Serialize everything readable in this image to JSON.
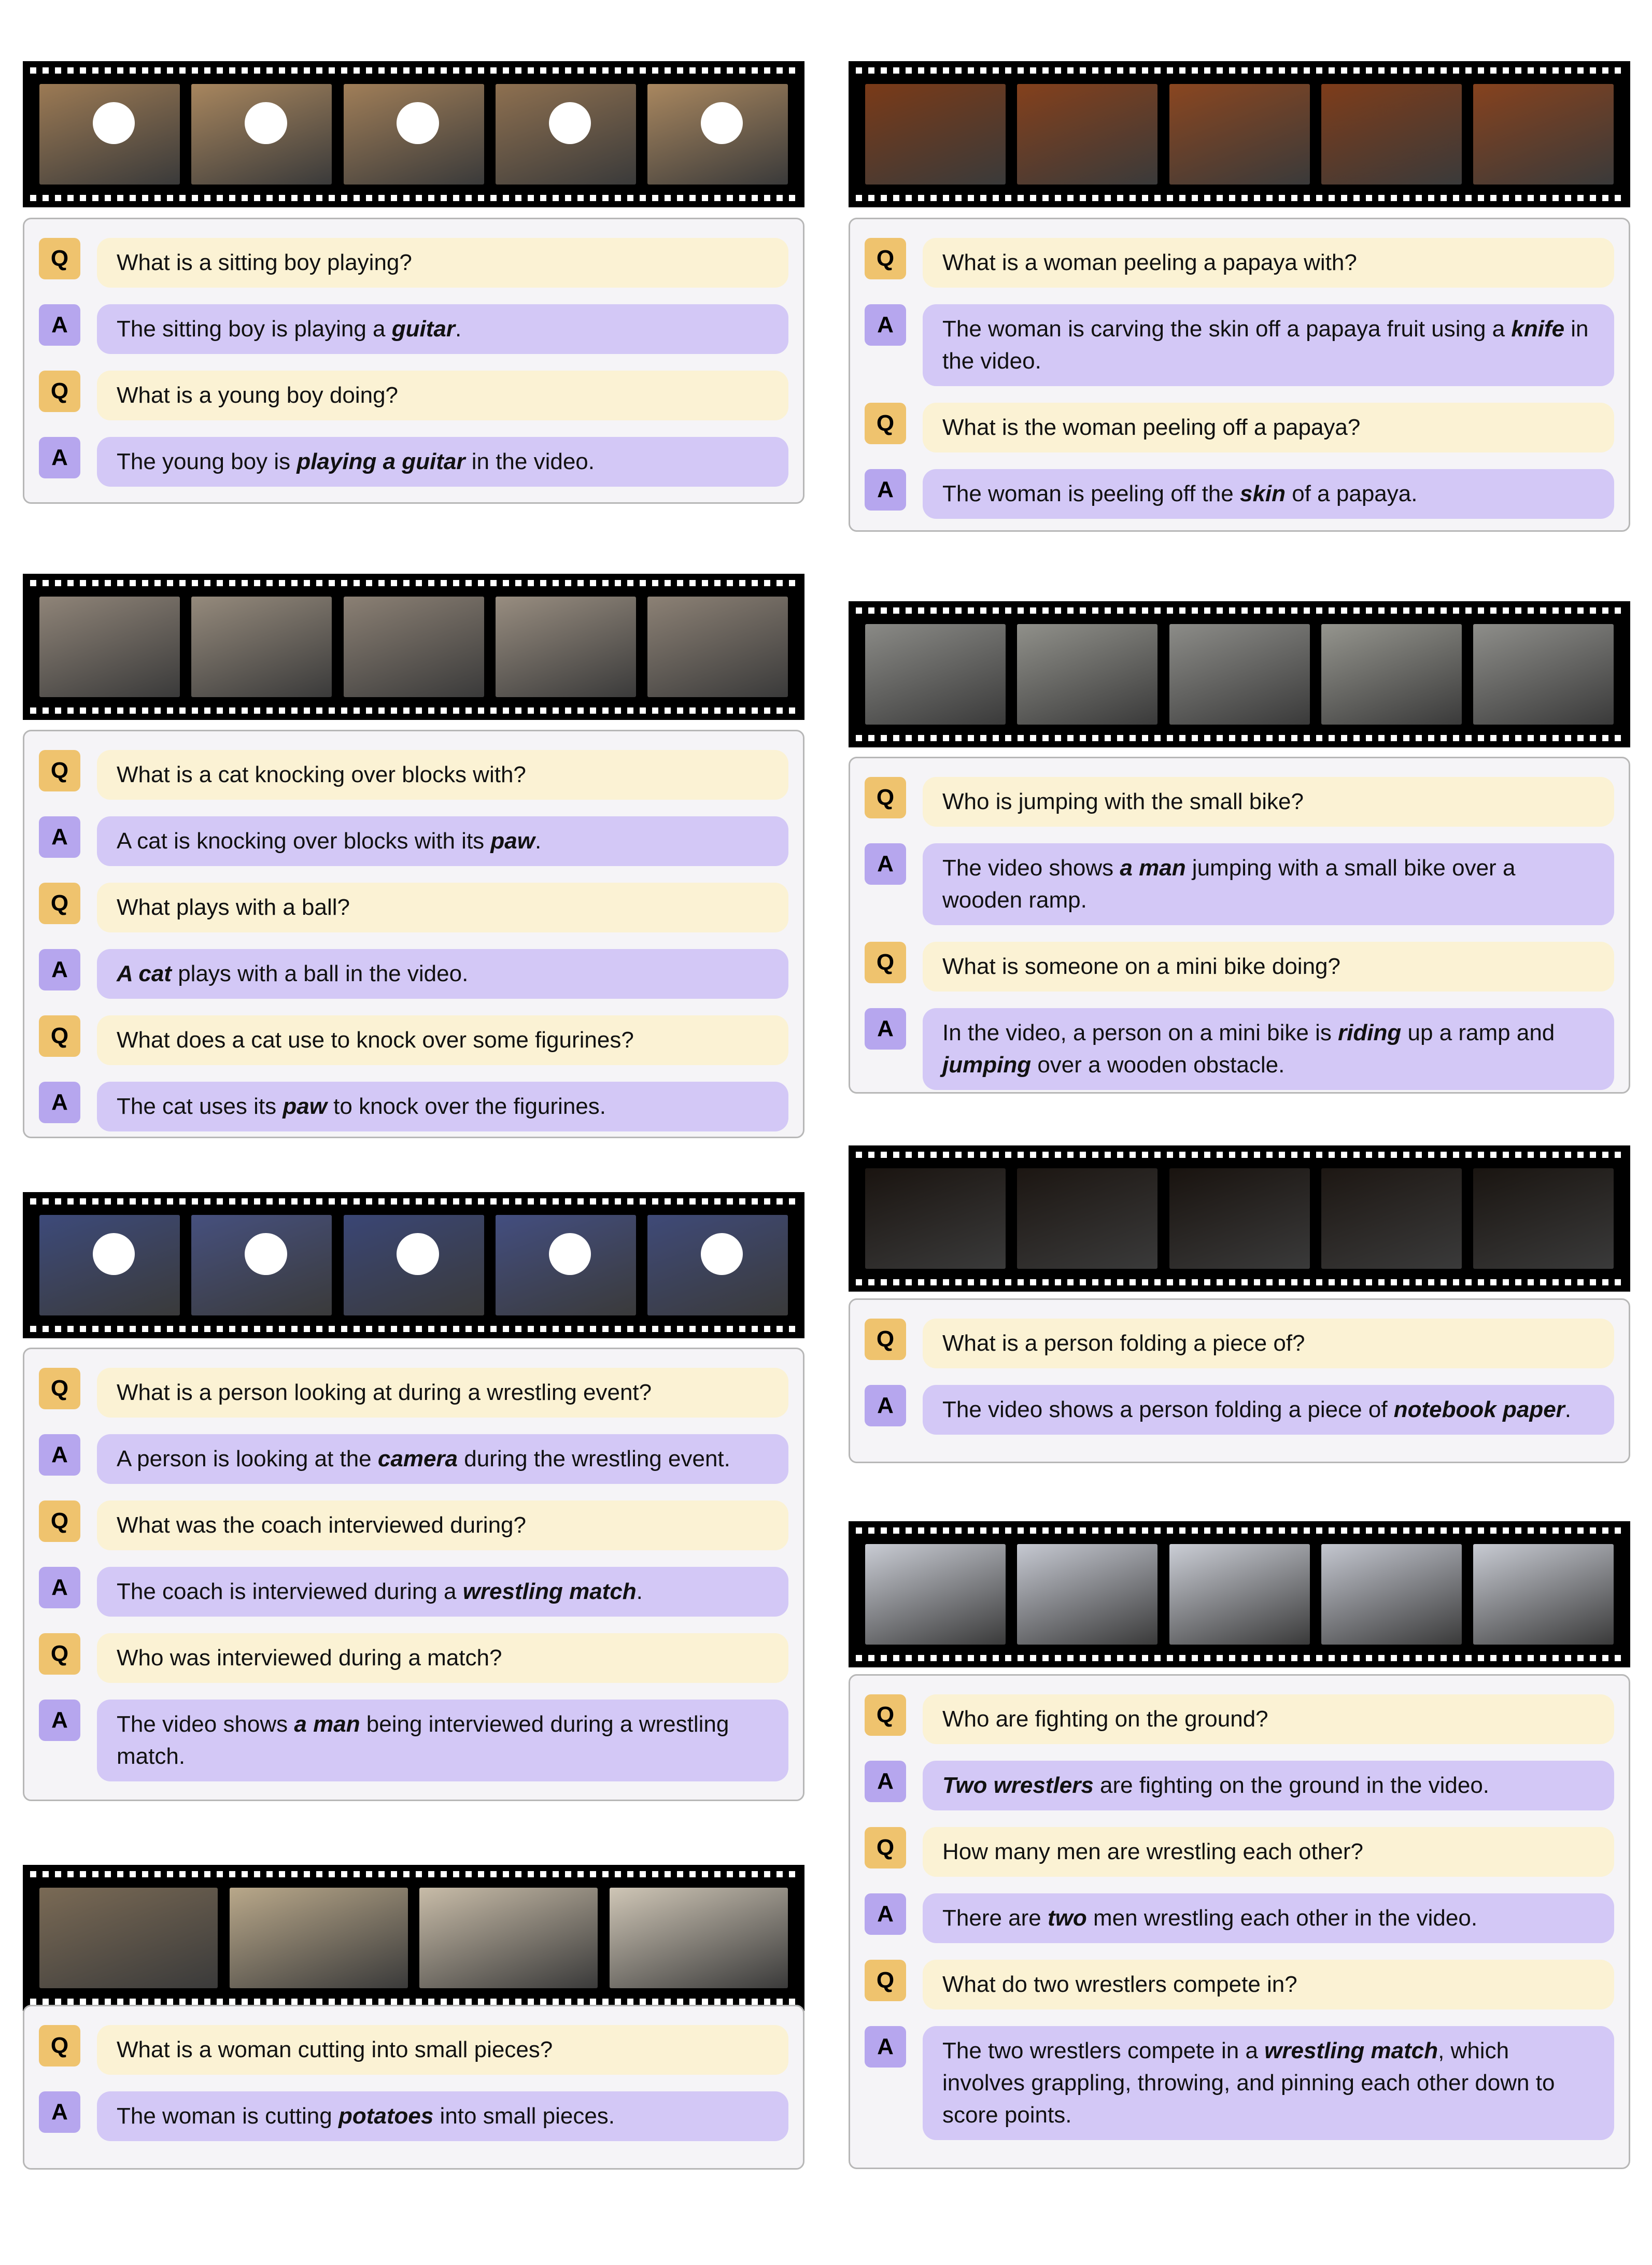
{
  "panels": [
    {
      "id": "boy-guitar",
      "frames": 5,
      "frame_colors": [
        "#9c7a54",
        "#a8865e",
        "#a07e58",
        "#8e7050",
        "#a9875f"
      ],
      "faces": true,
      "qa": [
        {
          "role": "Q",
          "parts": [
            {
              "t": "What is a sitting boy playing?"
            }
          ]
        },
        {
          "role": "A",
          "parts": [
            {
              "t": "The sitting boy is playing a "
            },
            {
              "t": "guitar",
              "em": true
            },
            {
              "t": "."
            }
          ]
        },
        {
          "role": "Q",
          "parts": [
            {
              "t": "What is a young boy doing?"
            }
          ]
        },
        {
          "role": "A",
          "parts": [
            {
              "t": "The young boy is "
            },
            {
              "t": "playing a guitar",
              "em": true
            },
            {
              "t": " in the video."
            }
          ]
        }
      ]
    },
    {
      "id": "cat-blocks",
      "frames": 5,
      "frame_colors": [
        "#8f8478",
        "#958a7c",
        "#8b8074",
        "#988d80",
        "#8c8175"
      ],
      "faces": false,
      "qa": [
        {
          "role": "Q",
          "parts": [
            {
              "t": "What is a cat knocking over blocks with?"
            }
          ]
        },
        {
          "role": "A",
          "parts": [
            {
              "t": "A cat is knocking over blocks with its "
            },
            {
              "t": "paw",
              "em": true
            },
            {
              "t": "."
            }
          ]
        },
        {
          "role": "Q",
          "parts": [
            {
              "t": "What plays with a ball?"
            }
          ]
        },
        {
          "role": "A",
          "parts": [
            {
              "t": "A cat",
              "em": true
            },
            {
              "t": " plays with a ball in the video."
            }
          ]
        },
        {
          "role": "Q",
          "parts": [
            {
              "t": "What does a cat use to knock over some figurines?"
            }
          ]
        },
        {
          "role": "A",
          "parts": [
            {
              "t": "The cat uses its "
            },
            {
              "t": "paw",
              "em": true
            },
            {
              "t": " to knock over the figurines."
            }
          ]
        }
      ]
    },
    {
      "id": "coach-interview",
      "frames": 5,
      "frame_colors": [
        "#3d4a7a",
        "#46507e",
        "#3a4675",
        "#434e80",
        "#3f4a78"
      ],
      "faces": true,
      "qa": [
        {
          "role": "Q",
          "parts": [
            {
              "t": "What is a person looking at during a wrestling event?"
            }
          ]
        },
        {
          "role": "A",
          "parts": [
            {
              "t": "A person is looking at the "
            },
            {
              "t": "camera",
              "em": true
            },
            {
              "t": " during the wrestling event."
            }
          ]
        },
        {
          "role": "Q",
          "parts": [
            {
              "t": "What was the coach interviewed during?"
            }
          ]
        },
        {
          "role": "A",
          "parts": [
            {
              "t": "The coach is interviewed during a "
            },
            {
              "t": "wrestling match",
              "em": true
            },
            {
              "t": "."
            }
          ]
        },
        {
          "role": "Q",
          "parts": [
            {
              "t": "Who was interviewed during a match?"
            }
          ]
        },
        {
          "role": "A",
          "parts": [
            {
              "t": "The video shows "
            },
            {
              "t": "a man",
              "em": true
            },
            {
              "t": " being interviewed during a wrestling match."
            }
          ]
        }
      ]
    },
    {
      "id": "potatoes",
      "frames": 4,
      "frame_colors": [
        "#7a6a55",
        "#b9a88a",
        "#c8bca8",
        "#cfc6b6"
      ],
      "faces": false,
      "qa": [
        {
          "role": "Q",
          "parts": [
            {
              "t": "What is a woman cutting into small pieces?"
            }
          ]
        },
        {
          "role": "A",
          "parts": [
            {
              "t": "The woman is cutting "
            },
            {
              "t": "potatoes",
              "em": true
            },
            {
              "t": " into small pieces."
            }
          ]
        }
      ]
    },
    {
      "id": "papaya",
      "frames": 5,
      "frame_colors": [
        "#7a3a18",
        "#84401c",
        "#8a4620",
        "#7e3c1a",
        "#86421e"
      ],
      "faces": false,
      "qa": [
        {
          "role": "Q",
          "parts": [
            {
              "t": "What is a woman peeling a papaya with?"
            }
          ]
        },
        {
          "role": "A",
          "parts": [
            {
              "t": "The woman is carving the skin off a papaya fruit using a "
            },
            {
              "t": "knife",
              "em": true
            },
            {
              "t": " in the video."
            }
          ]
        },
        {
          "role": "Q",
          "parts": [
            {
              "t": "What is the woman peeling off a papaya?"
            }
          ]
        },
        {
          "role": "A",
          "parts": [
            {
              "t": "The woman is peeling off the "
            },
            {
              "t": "skin",
              "em": true
            },
            {
              "t": " of a papaya."
            }
          ]
        }
      ]
    },
    {
      "id": "mini-bike",
      "frames": 5,
      "frame_colors": [
        "#8a8a86",
        "#90908a",
        "#8c8c88",
        "#95958e",
        "#8e8e8a"
      ],
      "faces": false,
      "qa": [
        {
          "role": "Q",
          "parts": [
            {
              "t": "Who is jumping with the small bike?"
            }
          ]
        },
        {
          "role": "A",
          "parts": [
            {
              "t": "The video shows "
            },
            {
              "t": "a man",
              "em": true
            },
            {
              "t": " jumping with a small bike over a wooden ramp."
            }
          ]
        },
        {
          "role": "Q",
          "parts": [
            {
              "t": "What is someone on a mini bike doing?"
            }
          ]
        },
        {
          "role": "A",
          "parts": [
            {
              "t": "In the video, a person on a mini bike is "
            },
            {
              "t": "riding",
              "em": true
            },
            {
              "t": " up a ramp and "
            },
            {
              "t": "jumping",
              "em": true
            },
            {
              "t": " over a wooden obstacle."
            }
          ]
        }
      ]
    },
    {
      "id": "paper-folding",
      "frames": 5,
      "frame_colors": [
        "#1a1410",
        "#1c1612",
        "#19130f",
        "#1d1713",
        "#1a1511"
      ],
      "faces": false,
      "qa": [
        {
          "role": "Q",
          "parts": [
            {
              "t": "What is a person folding a piece of?"
            }
          ]
        },
        {
          "role": "A",
          "parts": [
            {
              "t": "The video shows a person folding a piece of "
            },
            {
              "t": "notebook paper",
              "em": true
            },
            {
              "t": "."
            }
          ]
        }
      ]
    },
    {
      "id": "wrestlers",
      "frames": 5,
      "frame_colors": [
        "#c9ccd4",
        "#c6c9d2",
        "#cbced6",
        "#c4c7d0",
        "#c8cbd3"
      ],
      "faces": false,
      "qa": [
        {
          "role": "Q",
          "parts": [
            {
              "t": "Who are fighting on the ground?"
            }
          ]
        },
        {
          "role": "A",
          "parts": [
            {
              "t": "Two wrestlers",
              "em": true
            },
            {
              "t": " are fighting on the ground in the video."
            }
          ]
        },
        {
          "role": "Q",
          "parts": [
            {
              "t": "How many men are wrestling each other?"
            }
          ]
        },
        {
          "role": "A",
          "parts": [
            {
              "t": "There are "
            },
            {
              "t": "two",
              "em": true
            },
            {
              "t": " men wrestling each other in the video."
            }
          ]
        },
        {
          "role": "Q",
          "parts": [
            {
              "t": "What do two wrestlers compete in?"
            }
          ]
        },
        {
          "role": "A",
          "parts": [
            {
              "t": "The two wrestlers compete in a "
            },
            {
              "t": "wrestling match",
              "em": true
            },
            {
              "t": ", which involves grappling, throwing, and pinning each other down to score points."
            }
          ]
        }
      ]
    }
  ]
}
